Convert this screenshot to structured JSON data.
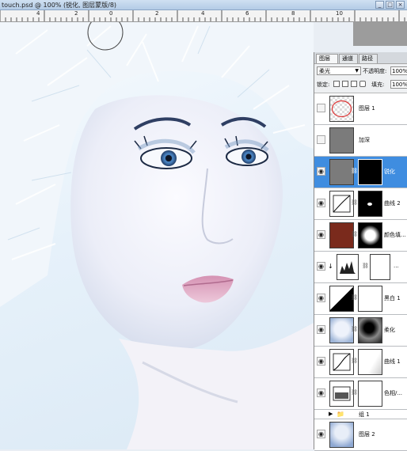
{
  "window": {
    "title": "touch.psd @ 100% (锐化, 图层蒙版/8)"
  },
  "ruler": {
    "ticks": [
      "4",
      "2",
      "0",
      "2",
      "4",
      "6",
      "8",
      "10"
    ]
  },
  "panel": {
    "tabs": [
      "图层",
      "通道",
      "路径"
    ],
    "close_glyph": "×",
    "blend_mode": "柔光",
    "opacity_label": "不透明度:",
    "opacity_value": "100%",
    "lock_label": "锁定:",
    "fill_label": "填充:",
    "fill_value": "100%"
  },
  "layers": [
    {
      "name": "图层 1",
      "visible": false,
      "selected": false
    },
    {
      "name": "加深",
      "visible": false,
      "selected": false
    },
    {
      "name": "锐化",
      "visible": true,
      "selected": true
    },
    {
      "name": "曲线 2",
      "visible": true,
      "selected": false
    },
    {
      "name": "颜色填...",
      "visible": true,
      "selected": false
    },
    {
      "name": "...",
      "visible": true,
      "selected": false
    },
    {
      "name": "黑白 1",
      "visible": true,
      "selected": false
    },
    {
      "name": "柔化",
      "visible": true,
      "selected": false
    },
    {
      "name": "曲线 1",
      "visible": true,
      "selected": false
    },
    {
      "name": "色相/...",
      "visible": true,
      "selected": false
    }
  ],
  "group": {
    "name": "组 1"
  },
  "bottom_layer": {
    "name": "图层 2"
  },
  "colors": {
    "selection": "#3f8de0",
    "fill_swatch": "#7a2a1c"
  }
}
